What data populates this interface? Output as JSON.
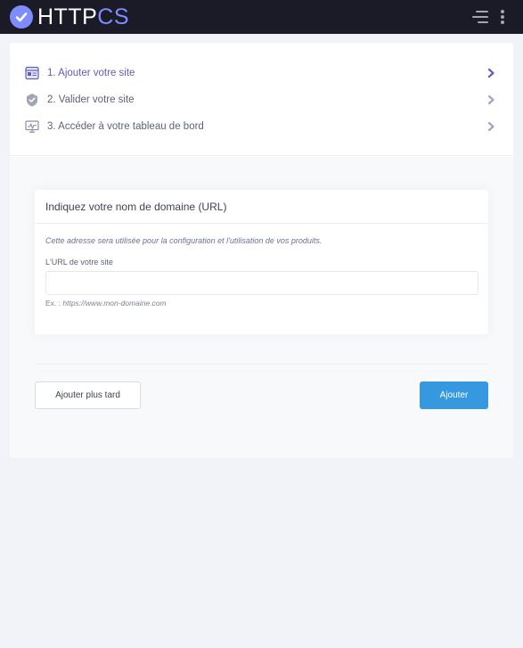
{
  "brand": {
    "name_part1": "HTTP",
    "name_part2": "CS",
    "colors": {
      "primary": "#7f8cff",
      "topbar": "#1b1b28",
      "button": "#3699e0"
    }
  },
  "header": {
    "icons": [
      "check-icon",
      "menu-icon",
      "more-vertical-icon"
    ]
  },
  "steps": [
    {
      "label": "1. Ajouter votre site",
      "icon": "browser-window-icon",
      "active": true
    },
    {
      "label": "2. Valider votre site",
      "icon": "shield-check-icon",
      "active": false
    },
    {
      "label": "3. Accéder à votre tableau de bord",
      "icon": "dashboard-monitor-icon",
      "active": false
    }
  ],
  "domain_form": {
    "title": "Indiquez votre nom de domaine (URL)",
    "hint": "Cette adresse sera utilisée pour la configuration et l'utilisation de vos produits.",
    "field_label": "L'URL de votre site",
    "input_value": "",
    "example_prefix": "Ex. : ",
    "example_value": "https://www.mon-domaine.com"
  },
  "actions": {
    "later_label": "Ajouter plus tard",
    "add_label": "Ajouter"
  }
}
